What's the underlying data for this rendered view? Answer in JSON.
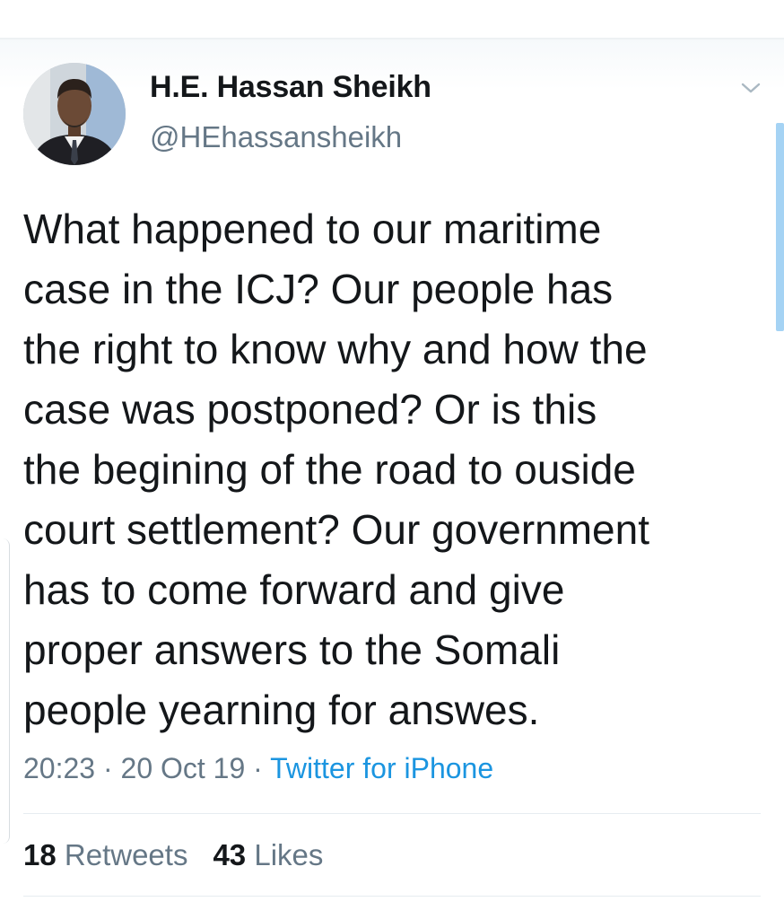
{
  "tweet": {
    "author": {
      "name": "H.E. Hassan Sheikh",
      "handle": "@HEhassansheikh"
    },
    "text": "What happened to our maritime\ncase in the ICJ? Our people has\nthe right to know why and how the\ncase was postponed? Or is this\nthe begining of the road to ouside\ncourt settlement? Our government\nhas to come forward and give\nproper answers to the Somali\npeople yearning for answes.",
    "time": "20:23",
    "date": "20 Oct 19",
    "separator": "·",
    "source": "Twitter for iPhone",
    "stats": {
      "retweets_count": "18",
      "retweets_label": "Retweets",
      "likes_count": "43",
      "likes_label": "Likes"
    }
  },
  "icons": {
    "menu": "chevron-down-icon",
    "avatar": "profile-photo"
  },
  "colors": {
    "text": "#14171a",
    "secondary": "#657786",
    "link": "#1b95e0",
    "scrollbar": "#a5d3f4"
  }
}
